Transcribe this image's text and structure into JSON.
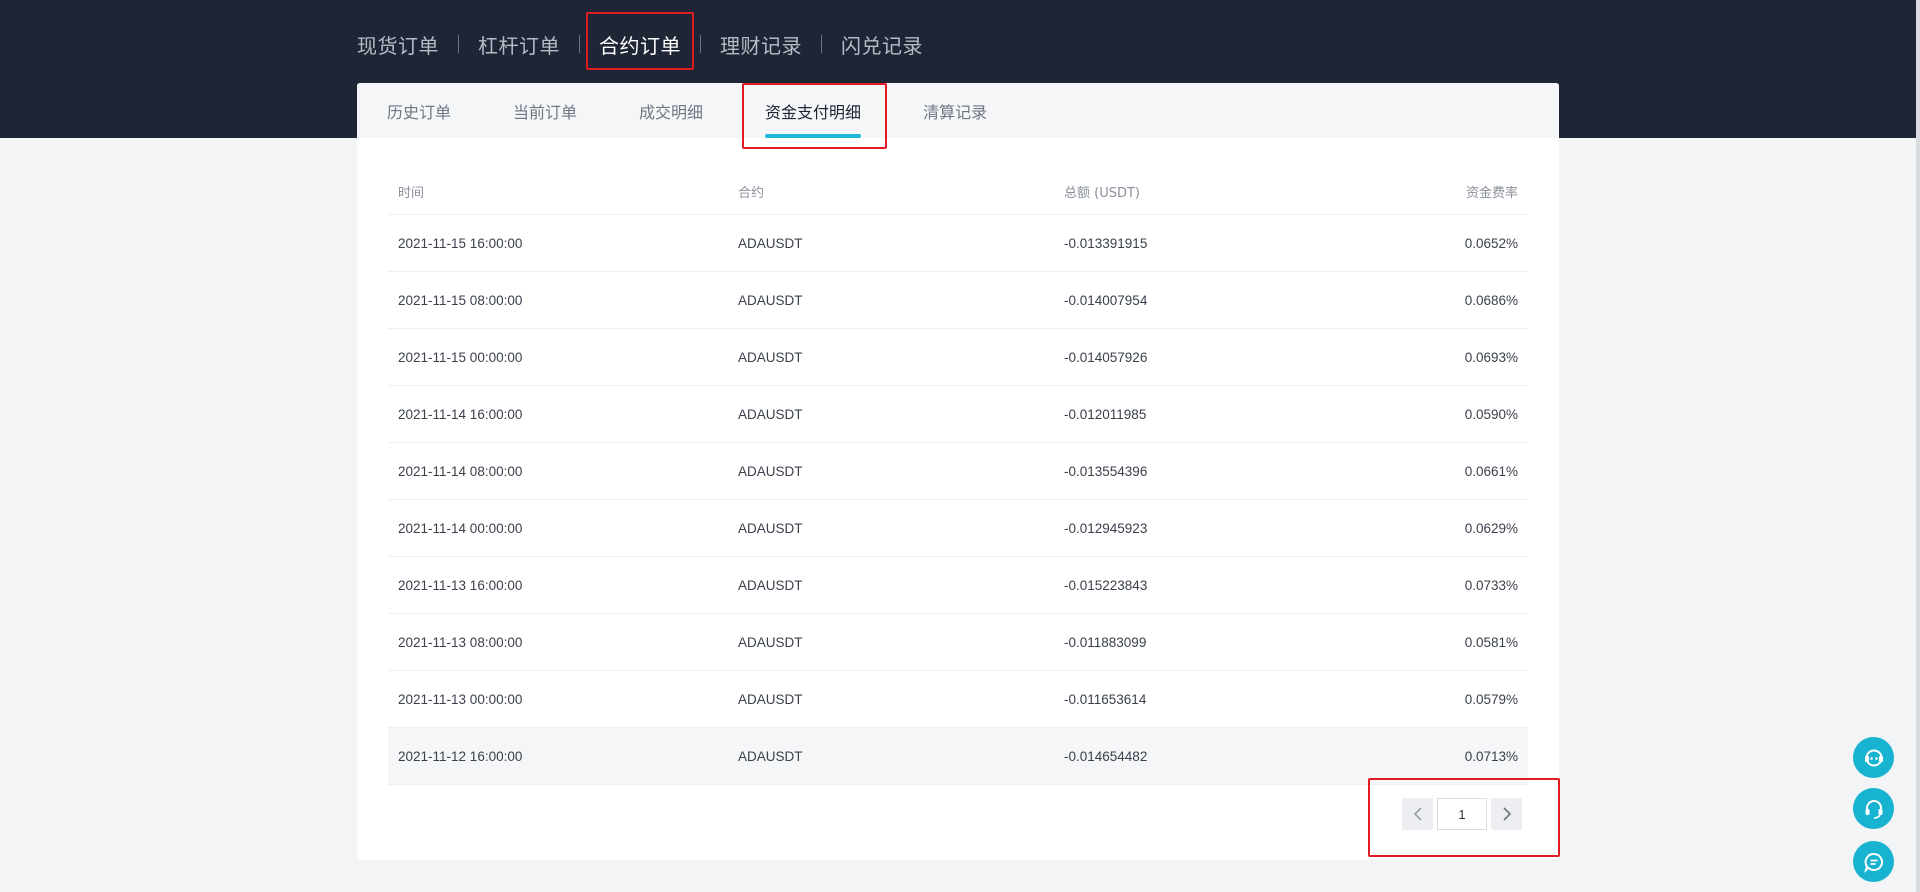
{
  "main_nav": [
    {
      "label": "现货订单"
    },
    {
      "label": "杠杆订单"
    },
    {
      "label": "合约订单"
    },
    {
      "label": "理财记录"
    },
    {
      "label": "闪兑记录"
    }
  ],
  "sub_tabs": [
    {
      "label": "历史订单"
    },
    {
      "label": "当前订单"
    },
    {
      "label": "成交明细"
    },
    {
      "label": "资金支付明细"
    },
    {
      "label": "清算记录"
    }
  ],
  "table": {
    "headers": [
      "时间",
      "合约",
      "总额 (USDT)",
      "资金费率"
    ],
    "rows": [
      [
        "2021-11-15 16:00:00",
        "ADAUSDT",
        "-0.013391915",
        "0.0652%"
      ],
      [
        "2021-11-15 08:00:00",
        "ADAUSDT",
        "-0.014007954",
        "0.0686%"
      ],
      [
        "2021-11-15 00:00:00",
        "ADAUSDT",
        "-0.014057926",
        "0.0693%"
      ],
      [
        "2021-11-14 16:00:00",
        "ADAUSDT",
        "-0.012011985",
        "0.0590%"
      ],
      [
        "2021-11-14 08:00:00",
        "ADAUSDT",
        "-0.013554396",
        "0.0661%"
      ],
      [
        "2021-11-14 00:00:00",
        "ADAUSDT",
        "-0.012945923",
        "0.0629%"
      ],
      [
        "2021-11-13 16:00:00",
        "ADAUSDT",
        "-0.015223843",
        "0.0733%"
      ],
      [
        "2021-11-13 08:00:00",
        "ADAUSDT",
        "-0.011883099",
        "0.0581%"
      ],
      [
        "2021-11-13 00:00:00",
        "ADAUSDT",
        "-0.011653614",
        "0.0579%"
      ],
      [
        "2021-11-12 16:00:00",
        "ADAUSDT",
        "-0.014654482",
        "0.0713%"
      ]
    ]
  },
  "pagination": {
    "current_page": "1",
    "prev_icon": "chevron-left-icon",
    "next_icon": "chevron-right-icon"
  },
  "floating_buttons": [
    {
      "icon": "robot-service-icon"
    },
    {
      "icon": "headset-icon"
    },
    {
      "icon": "chat-bubble-icon"
    }
  ],
  "colors": {
    "header_bg": "#1e2535",
    "accent": "#1bb8d6",
    "highlight_box": "#e11b22"
  }
}
